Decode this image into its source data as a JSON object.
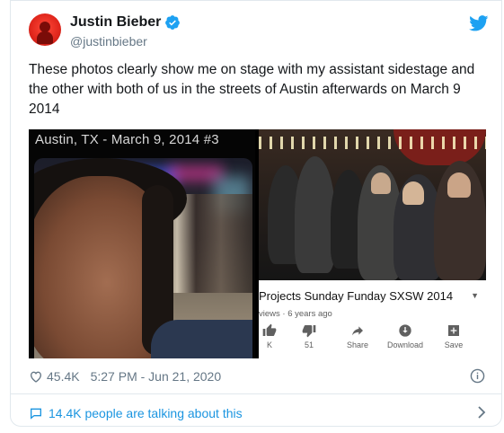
{
  "author": {
    "name": "Justin Bieber",
    "handle": "@justinbieber",
    "verified": true,
    "avatar_icon": "avatar-red"
  },
  "brand": {
    "icon": "twitter-bird-icon",
    "color": "#1da1f2"
  },
  "tweet": {
    "text": "These photos clearly show me on stage with my assistant sidestage and the other with both of us in the streets of Austin afterwards on March 9 2014"
  },
  "media": {
    "photo1": {
      "caption": "Austin, TX - March 9, 2014 #3"
    },
    "photo2": {
      "video_title": "Projects Sunday Funday SXSW 2014",
      "video_meta": "views · 6 years ago",
      "actions": [
        {
          "label": "K",
          "icon": "thumbs-up-icon"
        },
        {
          "label": "51",
          "icon": "thumbs-down-icon"
        },
        {
          "label": "Share",
          "icon": "share-icon"
        },
        {
          "label": "Download",
          "icon": "download-icon"
        },
        {
          "label": "Save",
          "icon": "save-icon"
        }
      ]
    }
  },
  "stats": {
    "likes": "45.4K",
    "timestamp": "5:27 PM - Jun 21, 2020"
  },
  "conversation": {
    "text": "14.4K people are talking about this"
  },
  "colors": {
    "text": "#14171a",
    "secondary": "#657786",
    "link": "#1b95e0",
    "verified": "#1da1f2",
    "border": "#e1e8ed"
  }
}
